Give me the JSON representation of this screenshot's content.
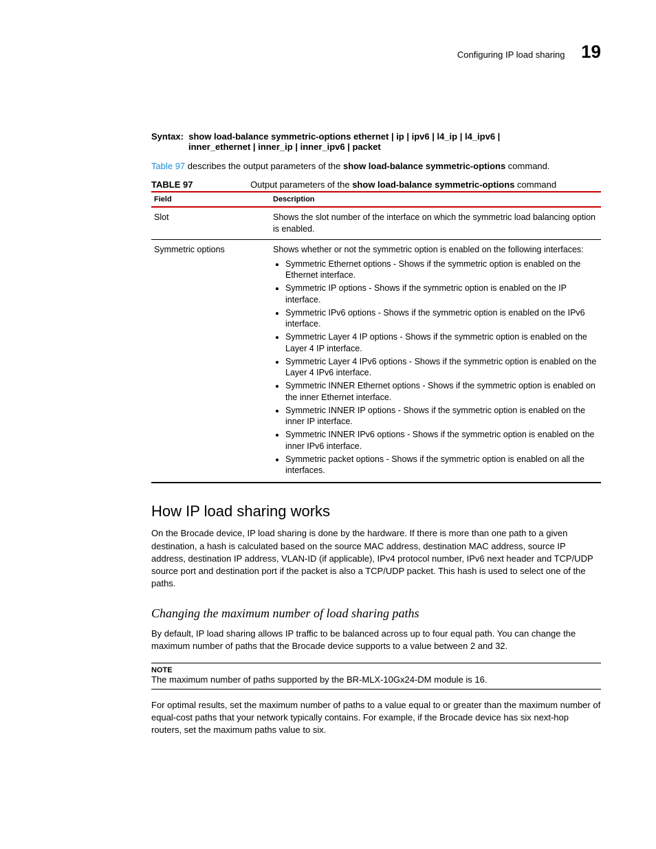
{
  "header": {
    "running_title": "Configuring IP load sharing",
    "chapter_number": "19"
  },
  "syntax": {
    "label": "Syntax:",
    "line1": "show load-balance symmetric-options ethernet | ip | ipv6 | l4_ip | l4_ipv6 |",
    "line2": "inner_ethernet | inner_ip | inner_ipv6 | packet"
  },
  "intro_para": {
    "link": "Table 97",
    "rest1": " describes the output parameters of the ",
    "bold": "show load-balance symmetric-options",
    "rest2": " command."
  },
  "table": {
    "label": "TABLE 97",
    "title_pre": "Output parameters of the ",
    "title_bold": "show load-balance symmetric-options",
    "title_post": " command",
    "head_field": "Field",
    "head_desc": "Description",
    "rows": [
      {
        "field": "Slot",
        "desc": "Shows the slot number of the interface on which the symmetric load balancing option is enabled."
      },
      {
        "field": "Symmetric options",
        "desc": "Shows whether or not the symmetric option is enabled on the following interfaces:",
        "bullets": [
          "Symmetric Ethernet options - Shows if the symmetric option is enabled on the Ethernet interface.",
          "Symmetric IP options - Shows if the symmetric option is enabled on the IP interface.",
          "Symmetric IPv6 options - Shows if the symmetric option is enabled on the IPv6 interface.",
          "Symmetric Layer 4 IP options - Shows if the symmetric option is enabled on the Layer 4 IP interface.",
          "Symmetric Layer 4 IPv6 options - Shows if the symmetric option is enabled on the Layer 4 IPv6 interface.",
          "Symmetric INNER Ethernet options - Shows if the symmetric option is enabled on the inner Ethernet interface.",
          "Symmetric INNER IP options - Shows if the symmetric option is enabled on the inner IP interface.",
          "Symmetric INNER IPv6 options - Shows if the symmetric option is enabled on the inner IPv6 interface.",
          "Symmetric packet options - Shows if the symmetric option is enabled on all the interfaces."
        ]
      }
    ]
  },
  "section": {
    "heading": "How IP load sharing works",
    "para": "On the Brocade device, IP load sharing is done by the hardware. If there is more than one path to a given destination, a hash is calculated based on the source MAC address, destination MAC address, source IP address, destination IP address, VLAN-ID (if applicable), IPv4 protocol number, IPv6 next header and TCP/UDP source port and destination port if the packet is also a TCP/UDP packet. This hash is used to select one of the paths."
  },
  "subsection": {
    "heading": "Changing the maximum number of load sharing paths",
    "para": "By default, IP load sharing allows IP traffic to be balanced across up to four equal path. You can change the maximum number of paths that the Brocade device supports to a value between 2 and 32.",
    "note_label": "NOTE",
    "note_body": "The maximum number of paths supported by the BR-MLX-10Gx24-DM module is 16.",
    "para2": "For optimal results, set the maximum number of paths to a value equal to or greater than the maximum number of equal-cost paths that your network typically contains. For example, if the Brocade device has six next-hop routers, set the maximum paths value to six."
  }
}
